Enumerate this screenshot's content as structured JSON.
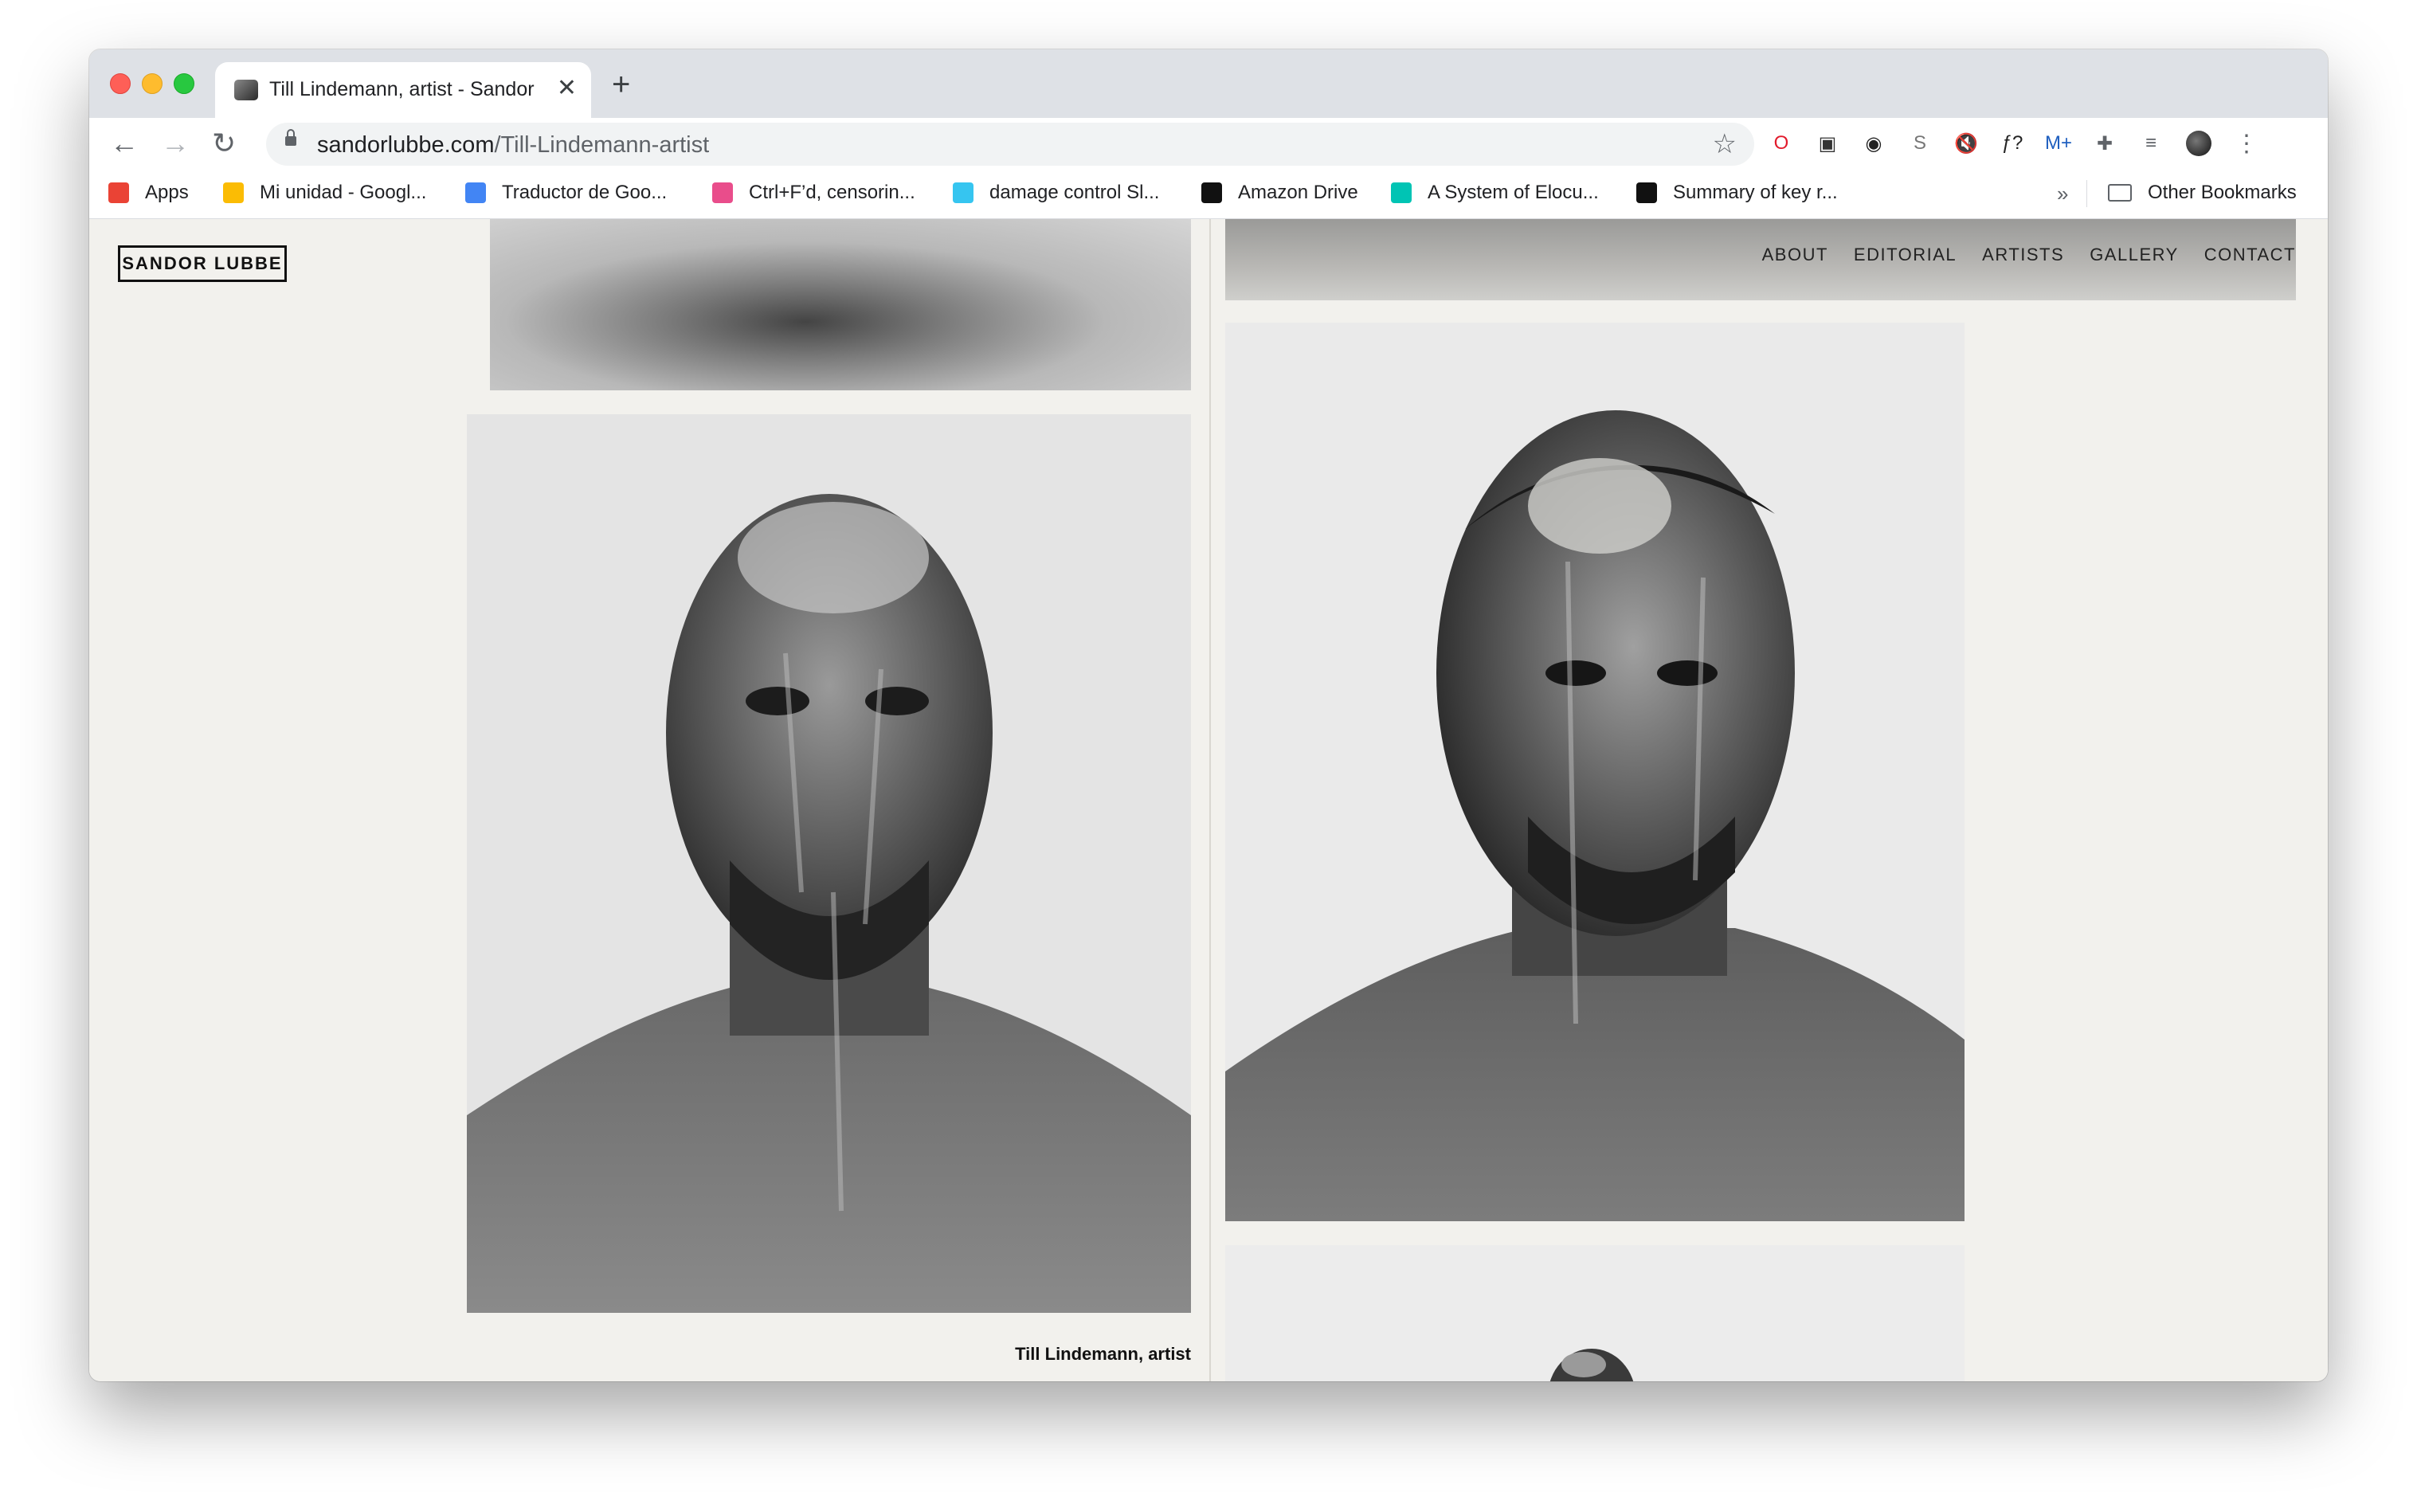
{
  "browser": {
    "tab_title": "Till Lindemann, artist - Sandor Lubbe",
    "url_domain": "sandorlubbe.com",
    "url_path": "/Till-Lindemann-artist",
    "icons": {
      "back": "arrow-left-icon",
      "forward": "arrow-right-icon",
      "reload": "reload-icon",
      "star": "star-icon",
      "close": "close-icon",
      "new_tab": "plus-icon",
      "menu": "kebab-menu-icon"
    },
    "extensions": [
      {
        "name": "opera-icon",
        "glyph": "O",
        "color": "#e21b2c"
      },
      {
        "name": "reader-icon",
        "glyph": "▣",
        "color": "#333333"
      },
      {
        "name": "compass-icon",
        "glyph": "◉",
        "color": "#222222"
      },
      {
        "name": "s-extension-icon",
        "glyph": "S",
        "color": "#777777"
      },
      {
        "name": "mute-icon",
        "glyph": "🔇",
        "color": "#555555"
      },
      {
        "name": "function-icon",
        "glyph": "ƒ?",
        "color": "#222222"
      },
      {
        "name": "movistar-icon",
        "glyph": "M+",
        "color": "#1f5fbf"
      },
      {
        "name": "puzzle-icon",
        "glyph": "✚",
        "color": "#5f6368"
      },
      {
        "name": "media-queue-icon",
        "glyph": "≡",
        "color": "#5f6368"
      }
    ]
  },
  "bookmarks": {
    "items": [
      {
        "label": "Apps",
        "icon": "apps-grid-icon",
        "color": "#ea4335"
      },
      {
        "label": "Mi unidad - Googl...",
        "icon": "google-drive-icon",
        "color": "#fbbc04"
      },
      {
        "label": "Traductor de Goo...",
        "icon": "google-translate-icon",
        "color": "#4285f4"
      },
      {
        "label": "Ctrl+F’d, censorin...",
        "icon": "news-icon",
        "color": "#e94d8b"
      },
      {
        "label": "damage control Sl...",
        "icon": "slack-icon",
        "color": "#36c5f0"
      },
      {
        "label": "Amazon Drive",
        "icon": "amazon-icon",
        "color": "#111111"
      },
      {
        "label": "A System of Elocu...",
        "icon": "google-play-icon",
        "color": "#00c4b4"
      },
      {
        "label": "Summary of key r...",
        "icon": "pt-icon",
        "color": "#111111"
      }
    ],
    "overflow": "»",
    "other": "Other Bookmarks"
  },
  "site": {
    "logo": "SANDOR LUBBE",
    "nav": [
      "ABOUT",
      "EDITORIAL",
      "ARTISTS",
      "GALLERY",
      "CONTACT"
    ],
    "caption": "Till Lindemann, artist"
  }
}
